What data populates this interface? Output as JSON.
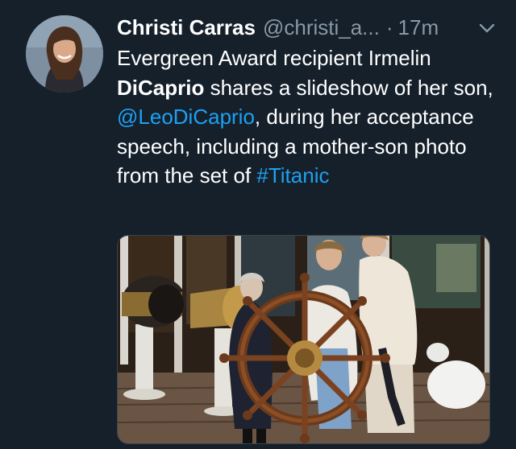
{
  "tweet": {
    "author": {
      "display_name": "Christi Carras",
      "handle": "@christi_a...",
      "avatar_icon": "profile-photo"
    },
    "separator": "·",
    "timestamp": "17m",
    "menu_icon": "chevron-down-icon",
    "text": {
      "segment_1": "Evergreen Award recipient Irmelin ",
      "segment_2_bold": "DiCaprio",
      "segment_3": " shares a slideshow of her son, ",
      "mention": "@LeoDiCaprio",
      "segment_4": ", during her acceptance speech, including a mother-son photo from the set of ",
      "hashtag": "#Titanic"
    },
    "media": {
      "type": "photo",
      "icon": "photo-ship-wheel"
    }
  },
  "colors": {
    "background": "#15202b",
    "primary_text": "#ffffff",
    "secondary_text": "#8899a6",
    "link": "#1da1f2"
  }
}
